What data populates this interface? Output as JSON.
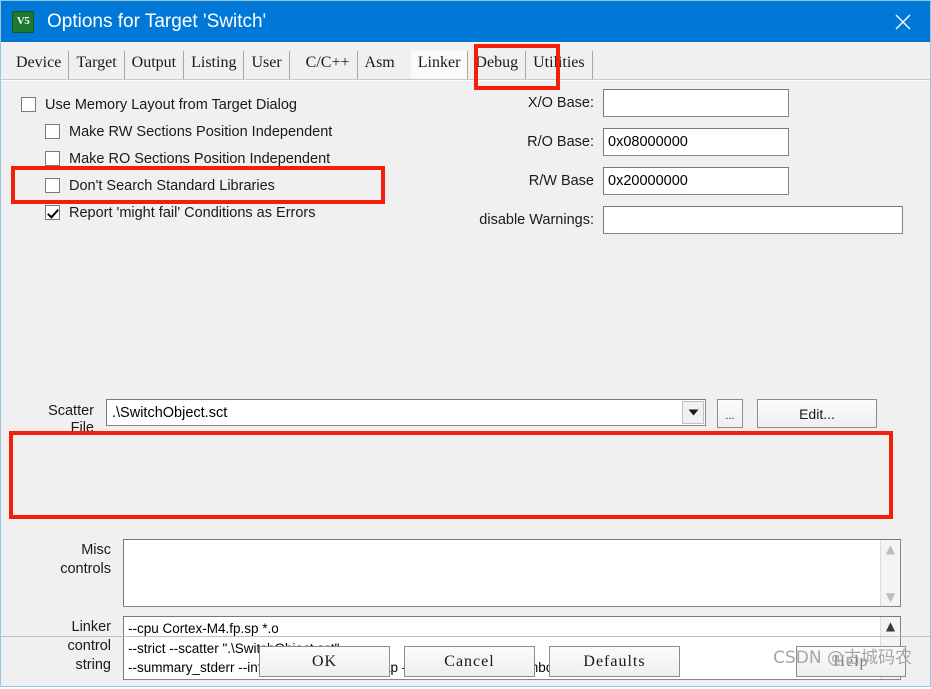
{
  "window": {
    "title": "Options for Target 'Switch'",
    "app_icon": "uvision-logo-icon",
    "close_icon": "close-icon",
    "titlebar_color": "#0078d7"
  },
  "tabs": [
    {
      "label": "Device",
      "active": false
    },
    {
      "label": "Target",
      "active": false
    },
    {
      "label": "Output",
      "active": false
    },
    {
      "label": "Listing",
      "active": false
    },
    {
      "label": "User",
      "active": false
    },
    {
      "label": "C/C++",
      "active": false
    },
    {
      "label": "Asm",
      "active": false
    },
    {
      "label": "Linker",
      "active": true
    },
    {
      "label": "Debug",
      "active": false
    },
    {
      "label": "Utilities",
      "active": false
    }
  ],
  "checkboxes": [
    {
      "label": "Use Memory Layout from Target Dialog",
      "checked": false,
      "indent": false
    },
    {
      "label": "Make RW Sections Position Independent",
      "checked": false,
      "indent": true
    },
    {
      "label": "Make RO Sections Position Independent",
      "checked": false,
      "indent": true
    },
    {
      "label": "Don't Search Standard Libraries",
      "checked": false,
      "indent": true
    },
    {
      "label": "Report 'might fail' Conditions as Errors",
      "checked": true,
      "indent": true
    }
  ],
  "base_fields": {
    "xo_base": {
      "label": "X/O Base:",
      "value": ""
    },
    "ro_base": {
      "label": "R/O Base:",
      "value": "0x08000000"
    },
    "rw_base": {
      "label": "R/W Base",
      "value": "0x20000000"
    },
    "disable_warnings": {
      "label": "disable Warnings:",
      "value": ""
    }
  },
  "scatter": {
    "label_line1": "Scatter",
    "label_line2": "File",
    "value": ".\\SwitchObject.sct",
    "dropdown_icon": "chevron-down-icon",
    "browse_label": "...",
    "edit_label": "Edit..."
  },
  "misc": {
    "label_line1": "Misc",
    "label_line2": "controls",
    "value": ""
  },
  "linker_string": {
    "label_line1": "Linker",
    "label_line2": "control",
    "label_line3": "string",
    "value": "--cpu Cortex-M4.fp.sp *.o\n--strict --scatter \".\\SwitchObject.sct\"\n--summary_stderr --info summarysizes --map --xref --callgraph --symbols",
    "scroll_up_icon": "chevron-up-icon",
    "scroll_down_icon": "chevron-down-icon"
  },
  "footer": {
    "ok_label": "OK",
    "cancel_label": "Cancel",
    "defaults_label": "Defaults",
    "help_label": "Help"
  },
  "annotations": {
    "color": "#f41f0b",
    "boxes": [
      {
        "name": "use-memory-layout-highlight"
      },
      {
        "name": "linker-tab-highlight"
      },
      {
        "name": "scatter-file-highlight"
      }
    ]
  },
  "watermark": {
    "text": "CSDN @古城码农"
  }
}
